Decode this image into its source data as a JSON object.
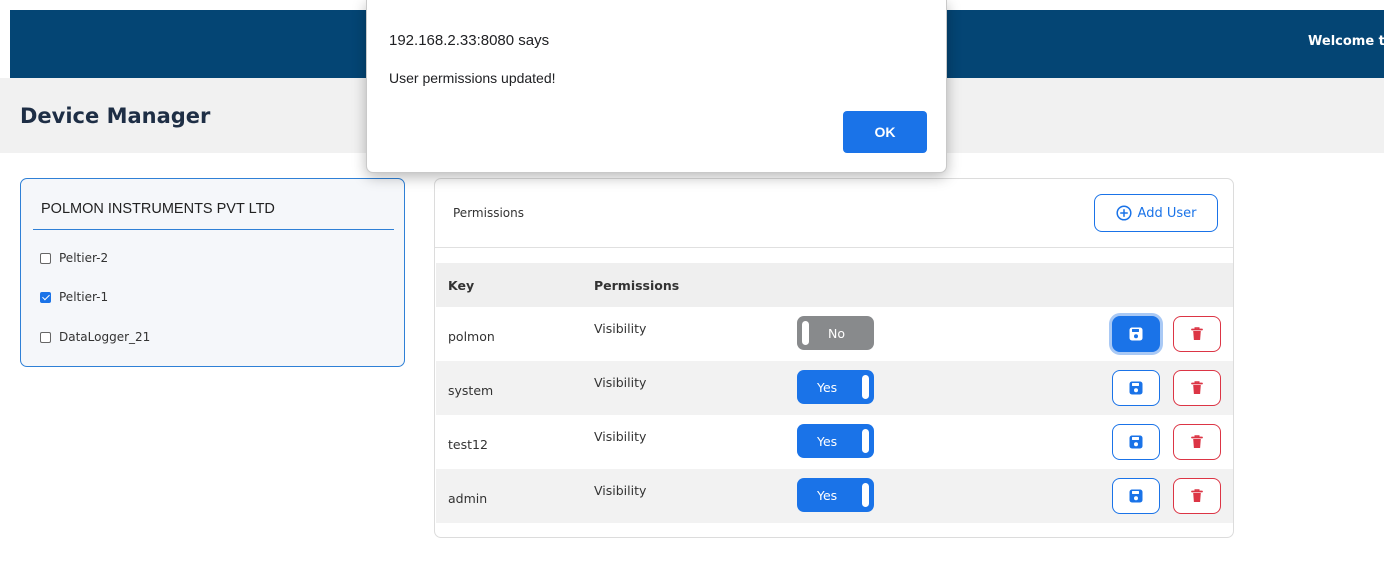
{
  "header": {
    "welcome_text": "Welcome to"
  },
  "page": {
    "title": "Device Manager"
  },
  "company": {
    "name": "POLMON INSTRUMENTS PVT LTD",
    "devices": [
      {
        "label": "Peltier-2",
        "checked": false
      },
      {
        "label": "Peltier-1",
        "checked": true
      },
      {
        "label": "DataLogger_21",
        "checked": false
      }
    ]
  },
  "permissions": {
    "section_label": "Permissions",
    "add_user_label": "Add User",
    "columns": {
      "key": "Key",
      "permissions": "Permissions"
    },
    "rows": [
      {
        "key": "polmon",
        "permission": "Visibility",
        "toggle": "No",
        "enabled": false
      },
      {
        "key": "system",
        "permission": "Visibility",
        "toggle": "Yes",
        "enabled": true
      },
      {
        "key": "test12",
        "permission": "Visibility",
        "toggle": "Yes",
        "enabled": true
      },
      {
        "key": "admin",
        "permission": "Visibility",
        "toggle": "Yes",
        "enabled": true
      }
    ]
  },
  "dialog": {
    "origin": "192.168.2.33:8080 says",
    "message": "User permissions updated!",
    "ok_label": "OK"
  },
  "colors": {
    "header_bg": "#044574",
    "accent": "#1a73e8",
    "danger": "#dc3545",
    "toggle_off": "#888a8c"
  }
}
